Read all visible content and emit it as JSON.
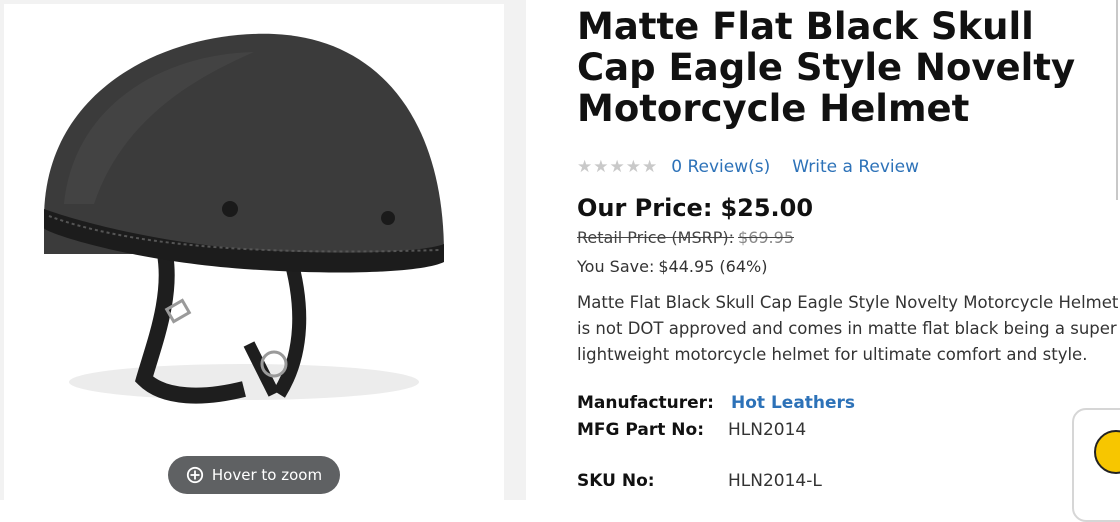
{
  "product": {
    "title": "Matte Flat Black Skull Cap Eagle Style Novelty Motorcycle Helmet",
    "rating": {
      "stars": 0,
      "max": 5,
      "reviews_label": "0 Review(s)",
      "write_label": "Write a Review"
    },
    "pricing": {
      "our_price_label": "Our Price:",
      "our_price_value": "$25.00",
      "retail_label": "Retail Price (MSRP):",
      "retail_value": "$69.95",
      "save_label": "You Save:",
      "save_value": "$44.95 (64%)"
    },
    "description": "Matte Flat Black Skull Cap Eagle Style Novelty Motorcycle Helmet is not DOT approved and comes in matte flat black being a super lightweight motorcycle helmet for ultimate comfort and style.",
    "specs": {
      "manufacturer_label": "Manufacturer:",
      "manufacturer_value": "Hot Leathers",
      "mfg_part_label": "MFG Part No:",
      "mfg_part_value": "HLN2014",
      "sku_label": "SKU No:",
      "sku_value": "HLN2014-L"
    }
  },
  "image": {
    "zoom_label": "Hover to zoom",
    "icon": "zoom-in-icon"
  },
  "colors": {
    "link": "#2d72b8",
    "zoom_pill": "#5f6163",
    "star_empty": "#c9c9c9"
  }
}
